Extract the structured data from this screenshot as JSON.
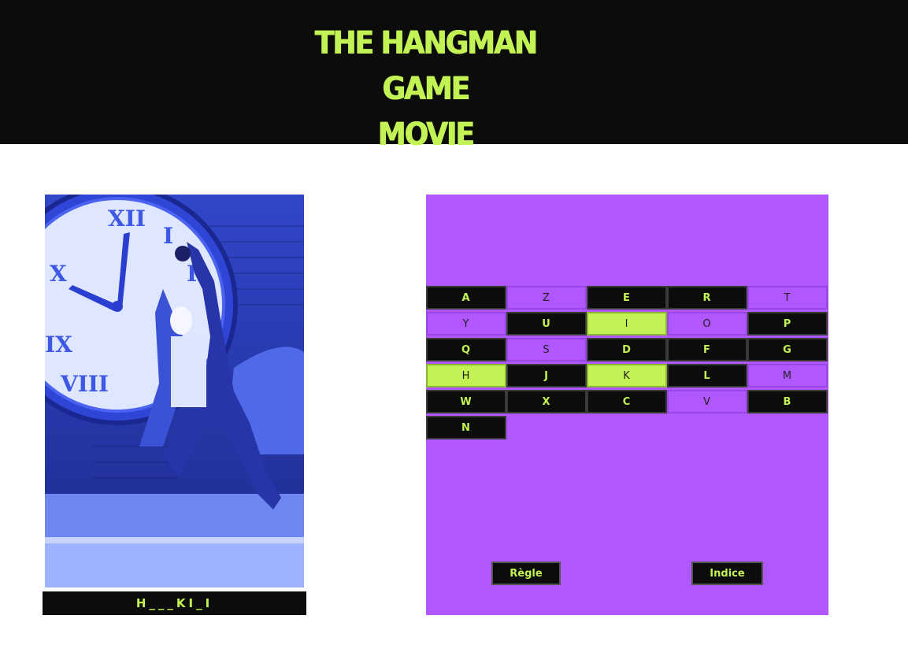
{
  "header": {
    "title_line1": "THE HANGMAN GAME",
    "title_line2": "MOVIE"
  },
  "puzzle": {
    "masked_word": "H___KI_I",
    "image_icon": "back-to-the-future-clock-tower-photo"
  },
  "keyboard": {
    "keys": [
      {
        "letter": "A",
        "state": "unused"
      },
      {
        "letter": "Z",
        "state": "wrong"
      },
      {
        "letter": "E",
        "state": "unused"
      },
      {
        "letter": "R",
        "state": "unused"
      },
      {
        "letter": "T",
        "state": "wrong"
      },
      {
        "letter": "Y",
        "state": "wrong"
      },
      {
        "letter": "U",
        "state": "unused"
      },
      {
        "letter": "I",
        "state": "right"
      },
      {
        "letter": "O",
        "state": "wrong"
      },
      {
        "letter": "P",
        "state": "unused"
      },
      {
        "letter": "Q",
        "state": "unused"
      },
      {
        "letter": "S",
        "state": "wrong"
      },
      {
        "letter": "D",
        "state": "unused"
      },
      {
        "letter": "F",
        "state": "unused"
      },
      {
        "letter": "G",
        "state": "unused"
      },
      {
        "letter": "H",
        "state": "right"
      },
      {
        "letter": "J",
        "state": "unused"
      },
      {
        "letter": "K",
        "state": "right"
      },
      {
        "letter": "L",
        "state": "unused"
      },
      {
        "letter": "M",
        "state": "wrong"
      },
      {
        "letter": "W",
        "state": "unused"
      },
      {
        "letter": "X",
        "state": "unused"
      },
      {
        "letter": "C",
        "state": "unused"
      },
      {
        "letter": "V",
        "state": "wrong"
      },
      {
        "letter": "B",
        "state": "unused"
      },
      {
        "letter": "N",
        "state": "unused"
      }
    ]
  },
  "buttons": {
    "rules_label": "Règle",
    "hint_label": "Indice"
  },
  "colors": {
    "accent": "#c2f253",
    "panel": "#b057ff",
    "dark": "#0c0c0b"
  }
}
